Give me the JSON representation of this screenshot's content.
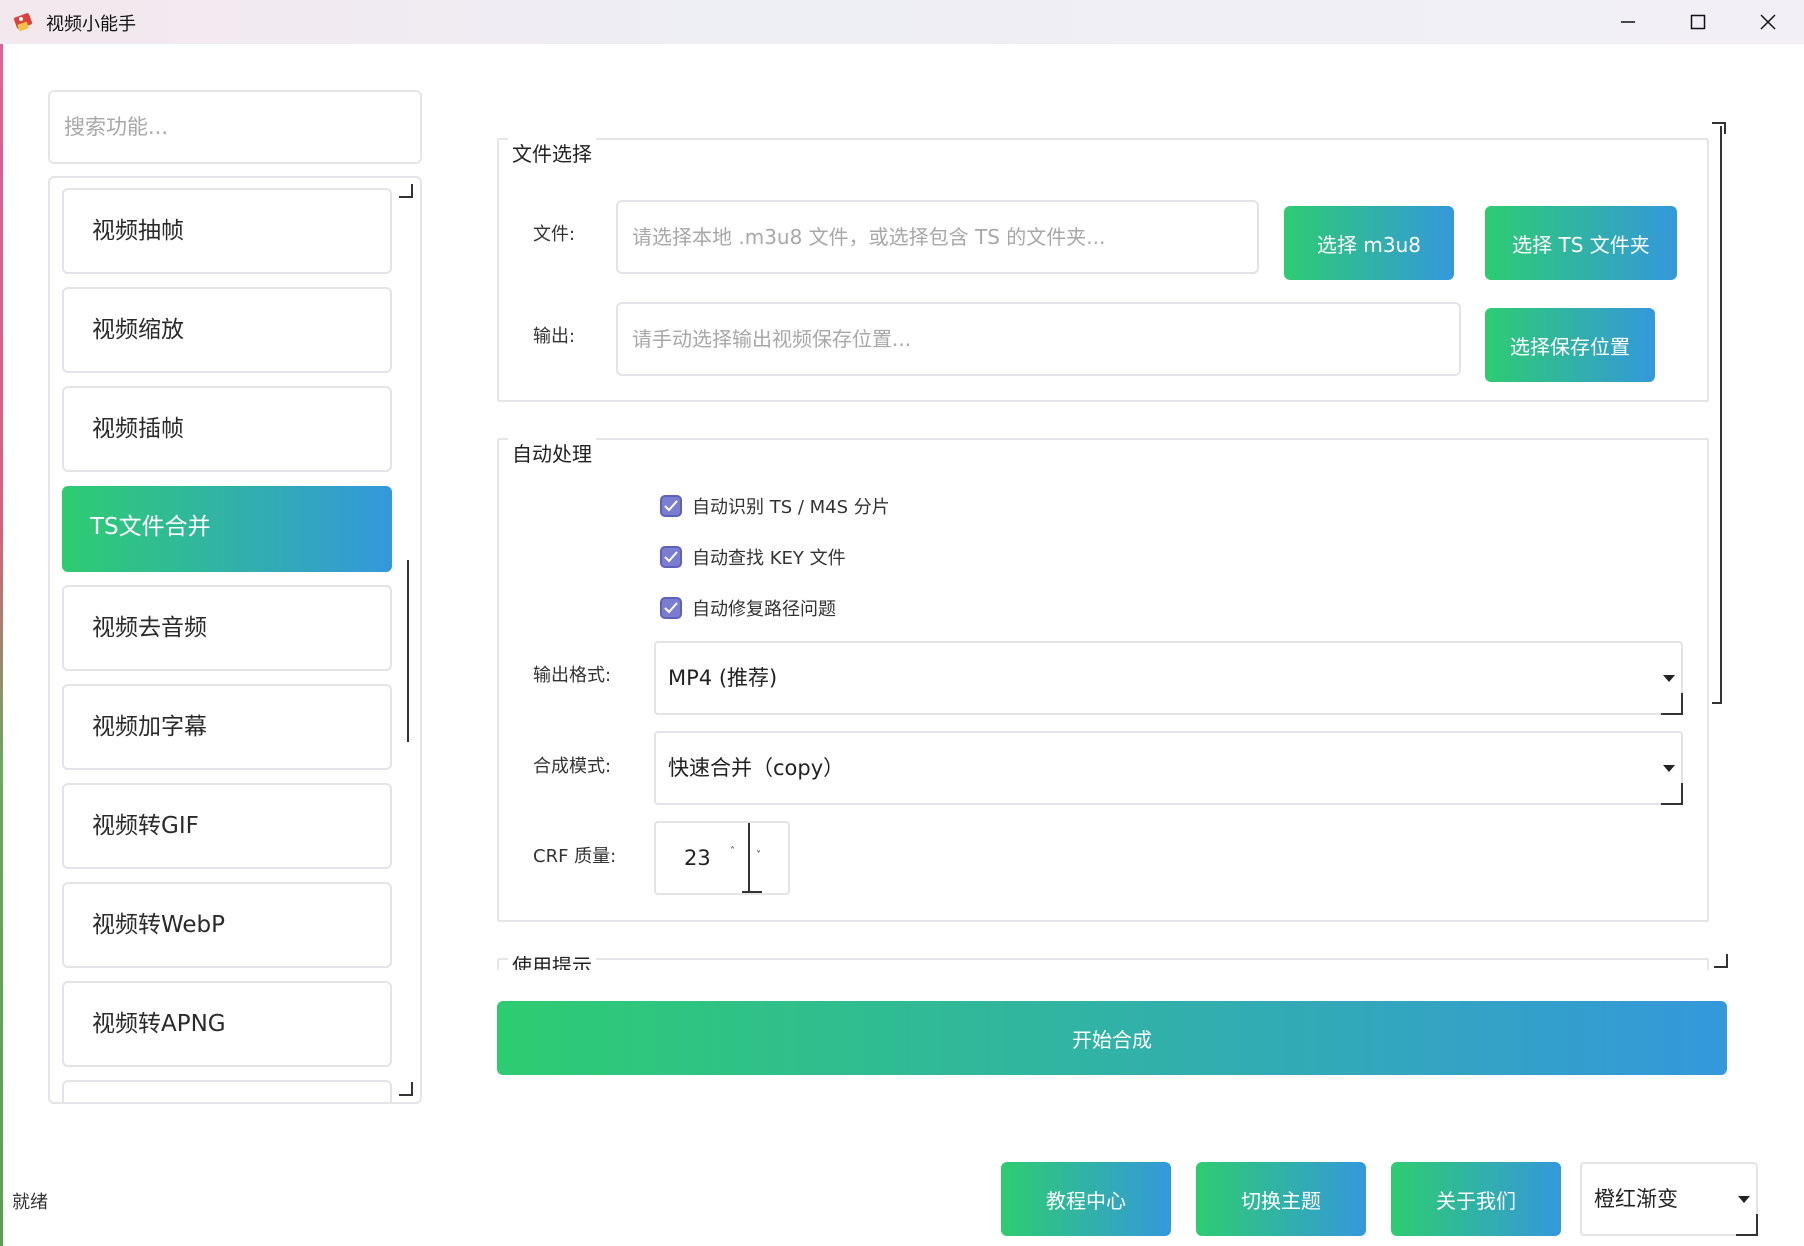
{
  "window": {
    "title": "视频小能手",
    "icon": "app-logo-icon"
  },
  "sidebar": {
    "search_placeholder": "搜索功能...",
    "items": [
      {
        "label": "视频抽帧",
        "active": false
      },
      {
        "label": "视频缩放",
        "active": false
      },
      {
        "label": "视频插帧",
        "active": false
      },
      {
        "label": "TS文件合并",
        "active": true
      },
      {
        "label": "视频去音频",
        "active": false
      },
      {
        "label": "视频加字幕",
        "active": false
      },
      {
        "label": "视频转GIF",
        "active": false
      },
      {
        "label": "视频转WebP",
        "active": false
      },
      {
        "label": "视频转APNG",
        "active": false
      }
    ]
  },
  "file_section": {
    "title": "文件选择",
    "file_label": "文件:",
    "file_placeholder": "请选择本地 .m3u8 文件，或选择包含 TS 的文件夹...",
    "select_m3u8": "选择 m3u8",
    "select_ts_folder": "选择 TS 文件夹",
    "output_label": "输出:",
    "output_placeholder": "请手动选择输出视频保存位置...",
    "select_save": "选择保存位置"
  },
  "auto_section": {
    "title": "自动处理",
    "checkboxes": [
      {
        "label": "自动识别 TS / M4S 分片",
        "checked": true
      },
      {
        "label": "自动查找 KEY 文件",
        "checked": true
      },
      {
        "label": "自动修复路径问题",
        "checked": true
      }
    ],
    "format_label": "输出格式:",
    "format_value": "MP4 (推荐)",
    "mode_label": "合成模式:",
    "mode_value": "快速合并（copy）",
    "crf_label": "CRF 质量:",
    "crf_value": "23"
  },
  "tips_section": {
    "title": "使用提示"
  },
  "start_button": "开始合成",
  "footer": {
    "status": "就绪",
    "tutorial": "教程中心",
    "switch_theme": "切换主题",
    "about": "关于我们",
    "theme_value": "橙红渐变"
  },
  "colors": {
    "gradient_start": "#2ecc71",
    "gradient_end": "#3498db",
    "checkbox": "#7b7ed0"
  }
}
